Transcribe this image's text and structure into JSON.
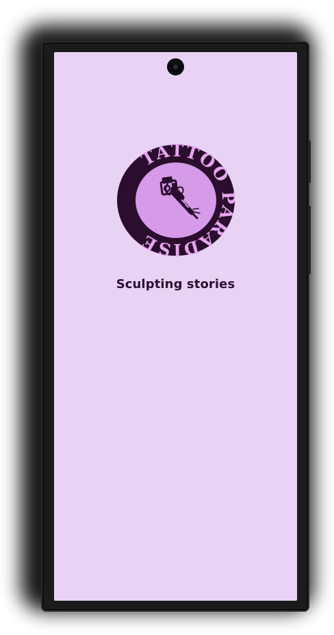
{
  "logo": {
    "brand_text": "TATTOO PARADISE",
    "icon": "tattoo-machine-icon",
    "colors": {
      "ring": "#2b0d2d",
      "inner": "#d59ae8",
      "letters": "#e6a6ef"
    }
  },
  "splash": {
    "tagline": "Sculpting stories"
  },
  "theme": {
    "screen_background": "#e9d3f5",
    "text_color": "#2a0f33"
  }
}
